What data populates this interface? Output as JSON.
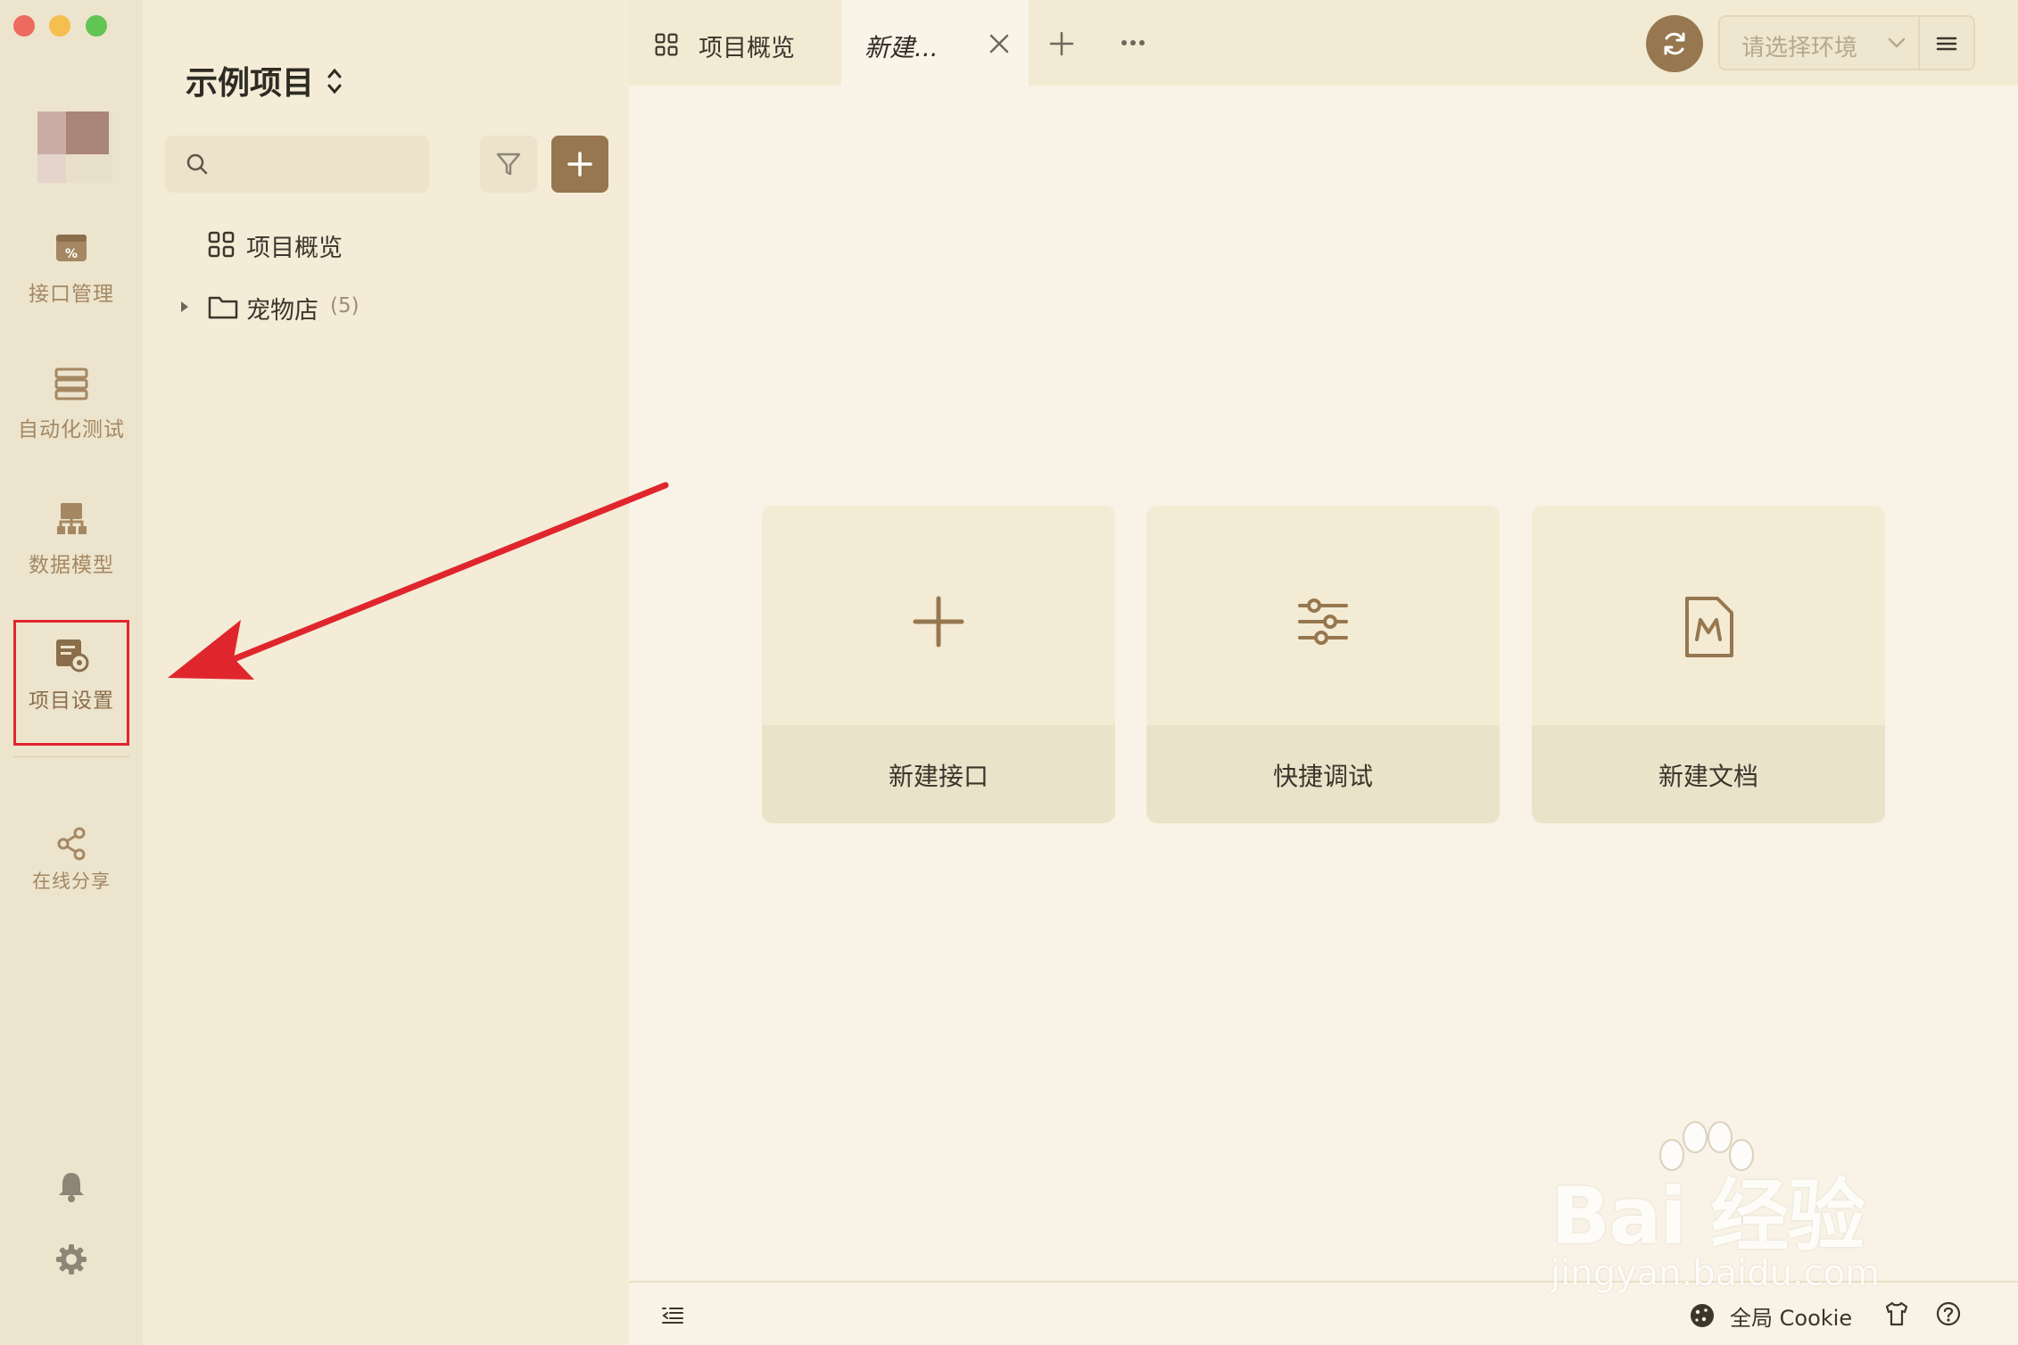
{
  "sidebar": {
    "items": [
      {
        "label": "接口管理",
        "icon": "api-management-icon"
      },
      {
        "label": "自动化测试",
        "icon": "automation-test-icon"
      },
      {
        "label": "数据模型",
        "icon": "data-model-icon"
      },
      {
        "label": "项目设置",
        "icon": "project-settings-icon"
      },
      {
        "label": "在线分享",
        "icon": "share-icon"
      }
    ],
    "bottom_icons": [
      "bell-icon",
      "gear-icon"
    ]
  },
  "project": {
    "title": "示例项目",
    "tree": {
      "overview_label": "项目概览",
      "folder_label": "宠物店",
      "folder_count": "(5)"
    }
  },
  "tabs": {
    "items": [
      {
        "label": "项目概览"
      },
      {
        "label": "新建..."
      }
    ]
  },
  "env": {
    "placeholder": "请选择环境"
  },
  "cards": [
    {
      "label": "新建接口",
      "icon": "plus-icon"
    },
    {
      "label": "快捷调试",
      "icon": "sliders-icon"
    },
    {
      "label": "新建文档",
      "icon": "markdown-doc-icon"
    }
  ],
  "statusbar": {
    "cookie_label": "全局 Cookie"
  },
  "watermark": {
    "brand": "Bai 经验",
    "url": "jingyan.baidu.com"
  },
  "colors": {
    "accent": "#96774f",
    "highlight": "#e0262d",
    "rail_bg": "#ede4cd"
  }
}
